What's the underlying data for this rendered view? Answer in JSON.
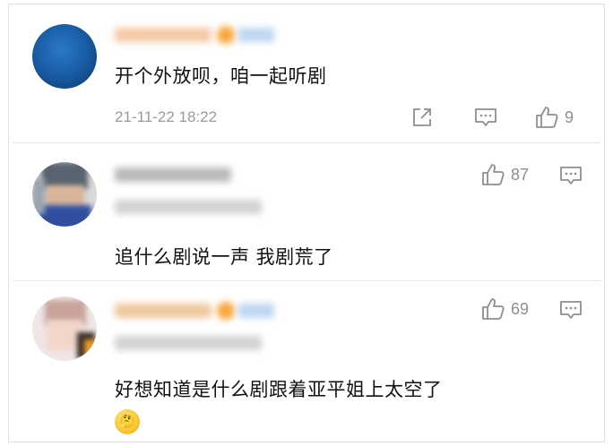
{
  "comments": [
    {
      "text": "开个外放呗，咱一起听剧",
      "timestamp": "21-11-22 18:22",
      "likes": "9",
      "actions": [
        "share-icon",
        "comment-icon",
        "like-icon"
      ]
    },
    {
      "text": "追什么剧说一声 我剧荒了",
      "likes": "87",
      "actions": [
        "like-icon",
        "comment-icon"
      ]
    },
    {
      "text": "好想知道是什么剧跟着亚平姐上太空了",
      "likes": "69",
      "emoji": "🤔",
      "actions": [
        "like-icon",
        "comment-icon"
      ]
    }
  ],
  "colors": {
    "text": "#111111",
    "meta": "#9a9a9a",
    "icon": "#8e8e8e",
    "divider": "#e6e6e6",
    "vip_badge": "#f7a53a"
  }
}
